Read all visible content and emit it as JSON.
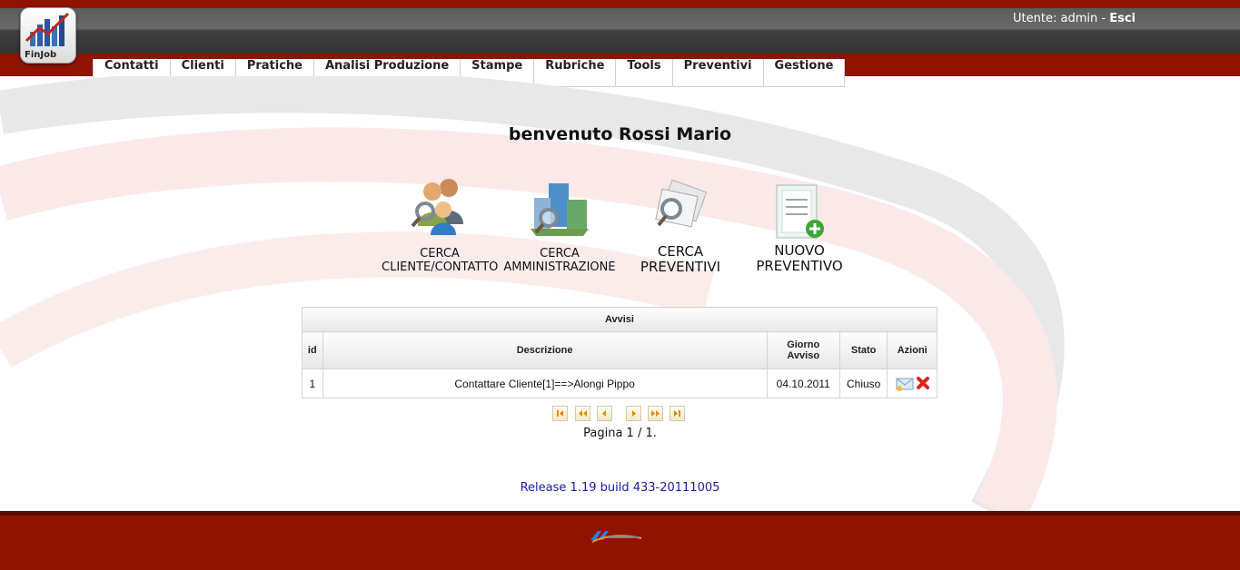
{
  "app": {
    "logo_text": "FinJob",
    "user_label": "Utente:",
    "user_name": "admin",
    "separator": "-",
    "logout_label": "Esci"
  },
  "nav": {
    "items": [
      "Contatti",
      "Clienti",
      "Pratiche",
      "Analisi Produzione",
      "Stampe",
      "Rubriche",
      "Tools",
      "Preventivi",
      "Gestione"
    ]
  },
  "welcome": "benvenuto Rossi Mario",
  "tiles": [
    {
      "line1": "CERCA",
      "line2": "CLIENTE/CONTATTO",
      "icon": "people-search-icon"
    },
    {
      "line1": "CERCA",
      "line2": "AMMINISTRAZIONE",
      "icon": "building-search-icon"
    },
    {
      "line1": "CERCA",
      "line2": "PREVENTIVI",
      "icon": "documents-search-icon"
    },
    {
      "line1": "NUOVO",
      "line2": "PREVENTIVO",
      "icon": "new-document-icon"
    }
  ],
  "avvisi": {
    "caption": "Avvisi",
    "columns": [
      "id",
      "Descrizione",
      "Giorno Avviso",
      "Stato",
      "Azioni"
    ],
    "rows": [
      {
        "id": "1",
        "descrizione": "Contattare Cliente[1]==>Alongi Pippo",
        "giorno": "04.10.2011",
        "stato": "Chiuso",
        "azioni": [
          "mail-icon",
          "delete-icon"
        ]
      }
    ]
  },
  "pagination": {
    "text": "Pagina 1 / 1."
  },
  "release": "Release 1.19 build 433-20111005",
  "colors": {
    "brand_red": "#8e1400",
    "link_blue": "#1a1aa8"
  }
}
